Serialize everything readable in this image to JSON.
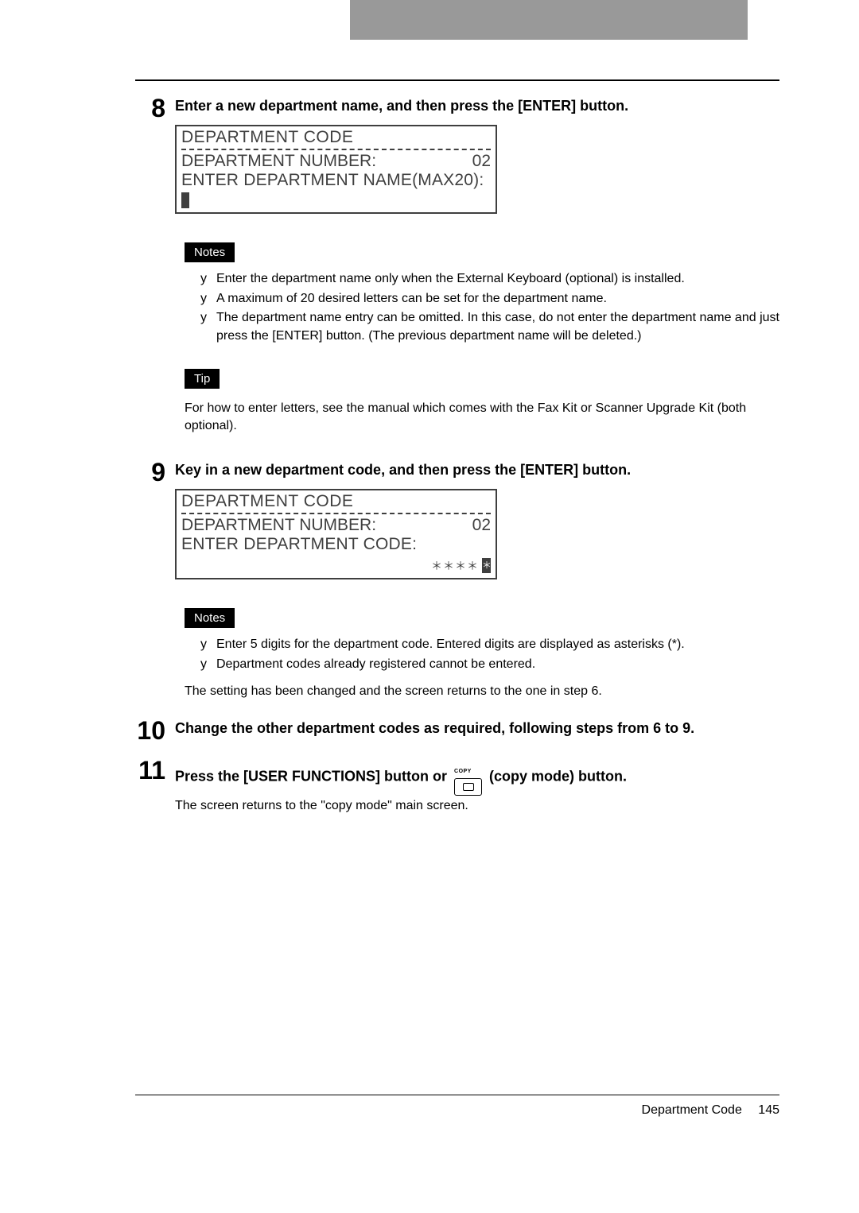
{
  "steps": {
    "s8": {
      "number": "8",
      "title": "Enter a new department name, and then press the [ENTER] button.",
      "lcd": {
        "title": "DEPARTMENT CODE",
        "line2_label": "DEPARTMENT NUMBER:",
        "line2_value": "02",
        "line3": "ENTER DEPARTMENT NAME(MAX20):"
      },
      "notes_label": "Notes",
      "notes": [
        "Enter the department name only when the External Keyboard (optional) is installed.",
        "A maximum of 20 desired letters can be set for the department name.",
        "The department name entry can be omitted. In this case, do not enter the department name and just press the [ENTER] button. (The previous department name will be deleted.)"
      ],
      "tip_label": "Tip",
      "tip_text": "For how to enter letters, see the manual which comes with the Fax Kit or Scanner Upgrade Kit (both optional)."
    },
    "s9": {
      "number": "9",
      "title": "Key in a new department code, and then press the [ENTER] button.",
      "lcd": {
        "title": "DEPARTMENT CODE",
        "line2_label": "DEPARTMENT NUMBER:",
        "line2_value": "02",
        "line3": "ENTER DEPARTMENT CODE:",
        "masked": "＊＊＊＊",
        "last_ast": "＊"
      },
      "notes_label": "Notes",
      "notes": [
        "Enter 5 digits for the department code. Entered digits are displayed as asterisks (*).",
        "Department codes already registered cannot be entered."
      ],
      "after_text": "The setting has been changed and the screen returns to the one in step 6."
    },
    "s10": {
      "number": "10",
      "title": "Change the other department codes as required, following steps from 6 to 9."
    },
    "s11": {
      "number": "11",
      "title_before": "Press the [USER FUNCTIONS] button or ",
      "title_after": " (copy mode) button.",
      "copy_label": "COPY",
      "sub_text": "The screen returns to the \"copy mode\" main screen."
    }
  },
  "bullet_char": "y",
  "footer": {
    "label": "Department Code",
    "page": "145"
  }
}
